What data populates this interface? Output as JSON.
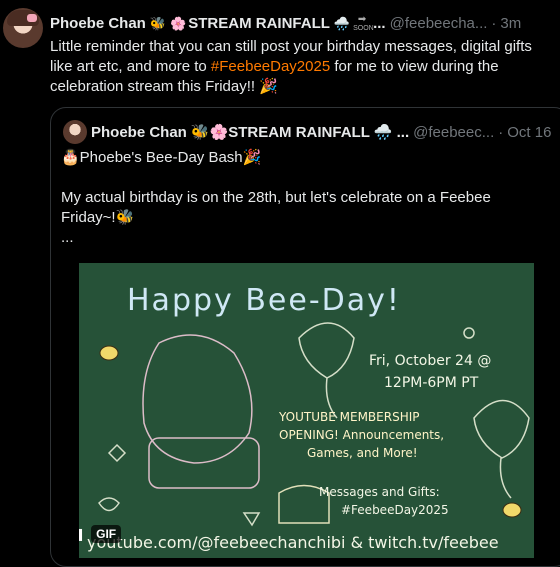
{
  "tweet": {
    "name": "Phoebe Chan",
    "handle": "@feebeecha...",
    "separator": "·",
    "time": "3m",
    "text_pre": "Little reminder that you can still post your birthday messages, digital gifts like art etc, and more to ",
    "hashtag": "#FeebeeDay2025",
    "text_post": " for me to view during the celebration stream this Friday!! 🎉"
  },
  "name_emojis": [
    "🐝",
    "🌸",
    "STREAM RAINFALL",
    "🌧️"
  ],
  "soon_label": "SOON",
  "quote": {
    "name": "Phoebe Chan",
    "name_suffix": "🐝🌸STREAM RAINFALL 🌧️ ...",
    "handle": "@feebeec...",
    "separator": "·",
    "time": "Oct 16",
    "line1": "🎂Phoebe's Bee-Day Bash🎉",
    "line2": "My actual birthday is on the 28th, but let's celebrate on a Feebee Friday~!🐝",
    "line3": "..."
  },
  "media": {
    "title": "Happy Bee-Day!",
    "date": "Fri, October 24 @",
    "time_range": "12PM-6PM PT",
    "line1": "YOUTUBE MEMBERSHIP",
    "line2": "OPENING! Announcements,",
    "line3": "Games, and More!",
    "gifts1": "Messages and Gifts:",
    "gifts2": "#FeebeeDay2025",
    "links": "youtube.com/@feebeechanchibi & twitch.tv/feebee",
    "gif_label": "GIF",
    "pause_icon": "pause-icon"
  },
  "colors": {
    "hashtag": "#ff7a00",
    "chalkboard": "#265238",
    "muted": "#71767b"
  }
}
